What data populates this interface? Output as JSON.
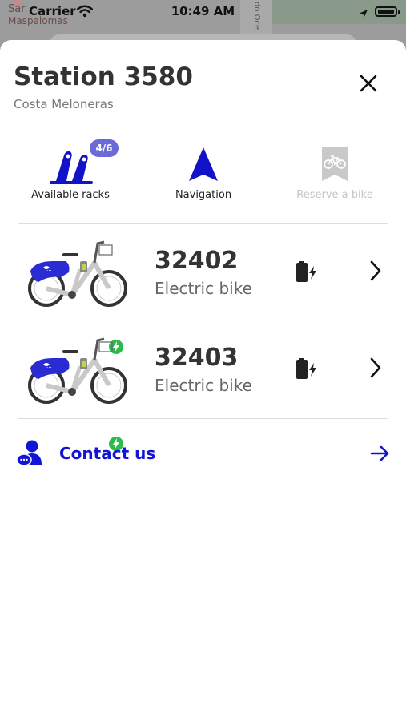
{
  "map": {
    "label_town_partial": "Sar",
    "label_town": "Maspalomas",
    "label_road": "do Oce"
  },
  "status_bar": {
    "carrier": "Carrier",
    "time": "10:49 AM"
  },
  "station": {
    "title": "Station 3580",
    "subtitle": "Costa Meloneras"
  },
  "actions": [
    {
      "label": "Available racks",
      "badge": "4/6",
      "icon": "bike-rack-icon",
      "enabled": true
    },
    {
      "label": "Navigation",
      "icon": "navigation-arrow-icon",
      "enabled": true
    },
    {
      "label": "Reserve a bike",
      "icon": "reserve-bike-bookmark-icon",
      "enabled": false
    }
  ],
  "bikes": [
    {
      "number": "32402",
      "type": "Electric bike",
      "icon": "electric-bike-icon",
      "battery_icon": "battery-charging-icon"
    },
    {
      "number": "32403",
      "type": "Electric bike",
      "icon": "electric-bike-icon",
      "battery_icon": "battery-charging-icon"
    }
  ],
  "contact": {
    "label": "Contact us",
    "icon": "support-agent-icon",
    "arrow_icon": "arrow-right-icon"
  },
  "colors": {
    "accent": "#1414d4",
    "badge": "#6b6bd8",
    "bike_blue": "#2b2bd4",
    "charge_green": "#2dbb4a",
    "disabled": "#c4c4c4"
  }
}
